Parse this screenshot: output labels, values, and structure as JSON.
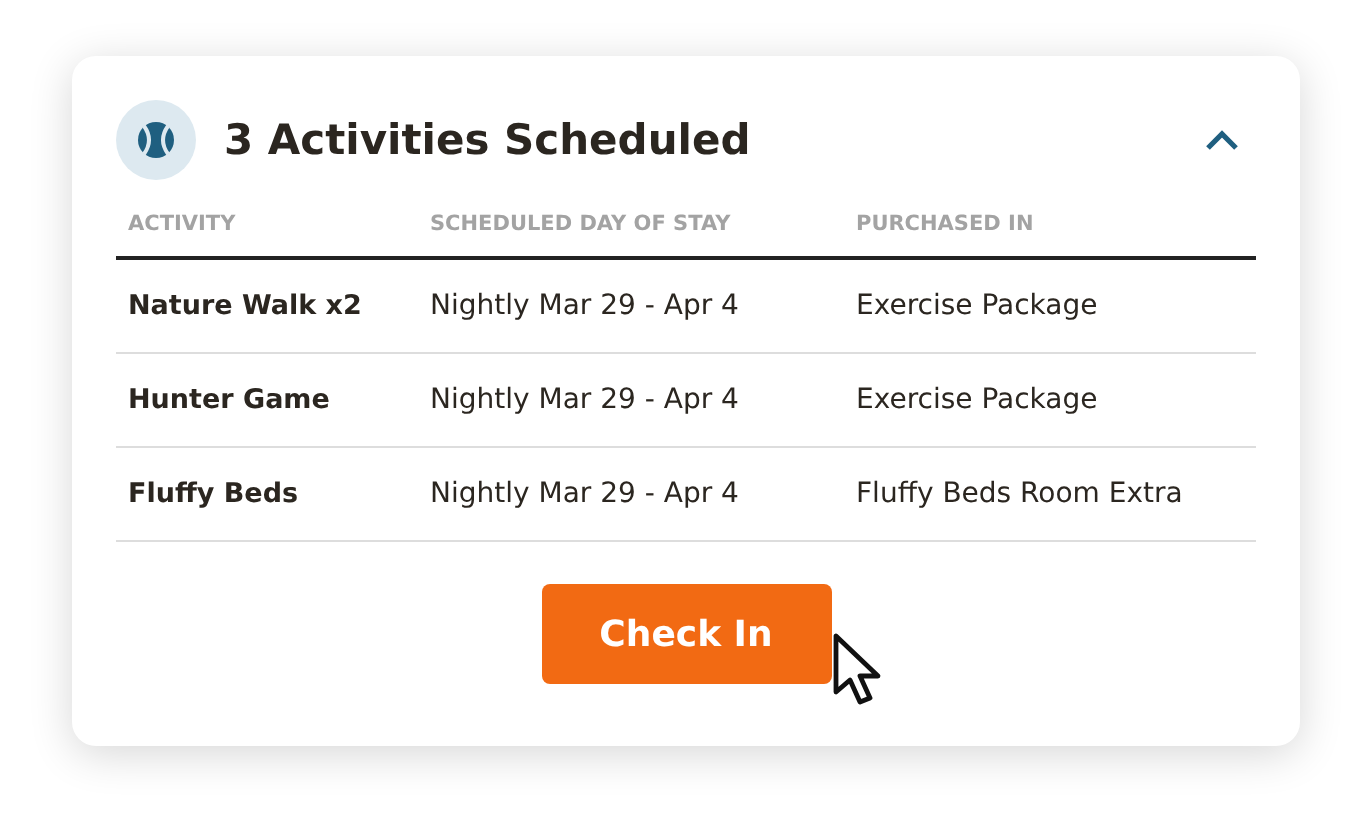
{
  "card": {
    "title": "3 Activities Scheduled",
    "expanded": true
  },
  "table": {
    "columns": [
      "ACTIVITY",
      "SCHEDULED DAY OF STAY",
      "PURCHASED IN"
    ],
    "rows": [
      {
        "activity": "Nature Walk x2",
        "day": "Nightly Mar 29 - Apr 4",
        "purchased_in": "Exercise Package"
      },
      {
        "activity": "Hunter Game",
        "day": "Nightly Mar 29 - Apr 4",
        "purchased_in": "Exercise Package"
      },
      {
        "activity": "Fluffy Beds",
        "day": "Nightly Mar 29 - Apr 4",
        "purchased_in": "Fluffy Beds Room Extra"
      }
    ]
  },
  "button": {
    "label": "Check In"
  }
}
